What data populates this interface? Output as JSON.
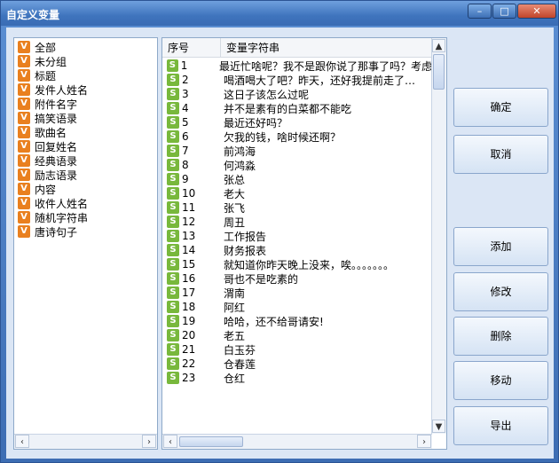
{
  "window": {
    "title": "自定义变量",
    "min_glyph": "–",
    "max_glyph": "□",
    "close_glyph": "✕"
  },
  "left_list": {
    "icon_letter": "V",
    "items": [
      "全部",
      "未分组",
      "标题",
      "发件人姓名",
      "附件名字",
      "搞笑语录",
      "歌曲名",
      "回复姓名",
      "经典语录",
      "励志语录",
      "内容",
      "收件人姓名",
      "随机字符串",
      "唐诗句子"
    ]
  },
  "table": {
    "columns": [
      "序号",
      "变量字符串"
    ],
    "icon_letter": "S",
    "rows": [
      {
        "num": "1",
        "text": "最近忙啥呢？我不是跟你说了那事了吗？考虑"
      },
      {
        "num": "2",
        "text": "喝酒喝大了吧？昨天，还好我提前走了…"
      },
      {
        "num": "3",
        "text": "这日子该怎么过呢"
      },
      {
        "num": "4",
        "text": "并不是素有的白菜都不能吃"
      },
      {
        "num": "5",
        "text": "最近还好吗？"
      },
      {
        "num": "6",
        "text": "欠我的钱，啥时候还啊？"
      },
      {
        "num": "7",
        "text": "前鸿海"
      },
      {
        "num": "8",
        "text": "何鸿淼"
      },
      {
        "num": "9",
        "text": "张总"
      },
      {
        "num": "10",
        "text": "老大"
      },
      {
        "num": "11",
        "text": "张飞"
      },
      {
        "num": "12",
        "text": "周丑"
      },
      {
        "num": "13",
        "text": "工作报告"
      },
      {
        "num": "14",
        "text": "财务报表"
      },
      {
        "num": "15",
        "text": "就知道你昨天晚上没来，唉。。。。。。。"
      },
      {
        "num": "16",
        "text": "哥也不是吃素的"
      },
      {
        "num": "17",
        "text": "渭南"
      },
      {
        "num": "18",
        "text": "阿红"
      },
      {
        "num": "19",
        "text": "哈哈，还不给哥请安!"
      },
      {
        "num": "20",
        "text": "老五"
      },
      {
        "num": "21",
        "text": "白玉芬"
      },
      {
        "num": "22",
        "text": "仓春莲"
      },
      {
        "num": "23",
        "text": "仓红"
      }
    ]
  },
  "buttons": {
    "ok": "确定",
    "cancel": "取消",
    "add": "添加",
    "edit": "修改",
    "delete": "删除",
    "move": "移动",
    "export": "导出"
  }
}
